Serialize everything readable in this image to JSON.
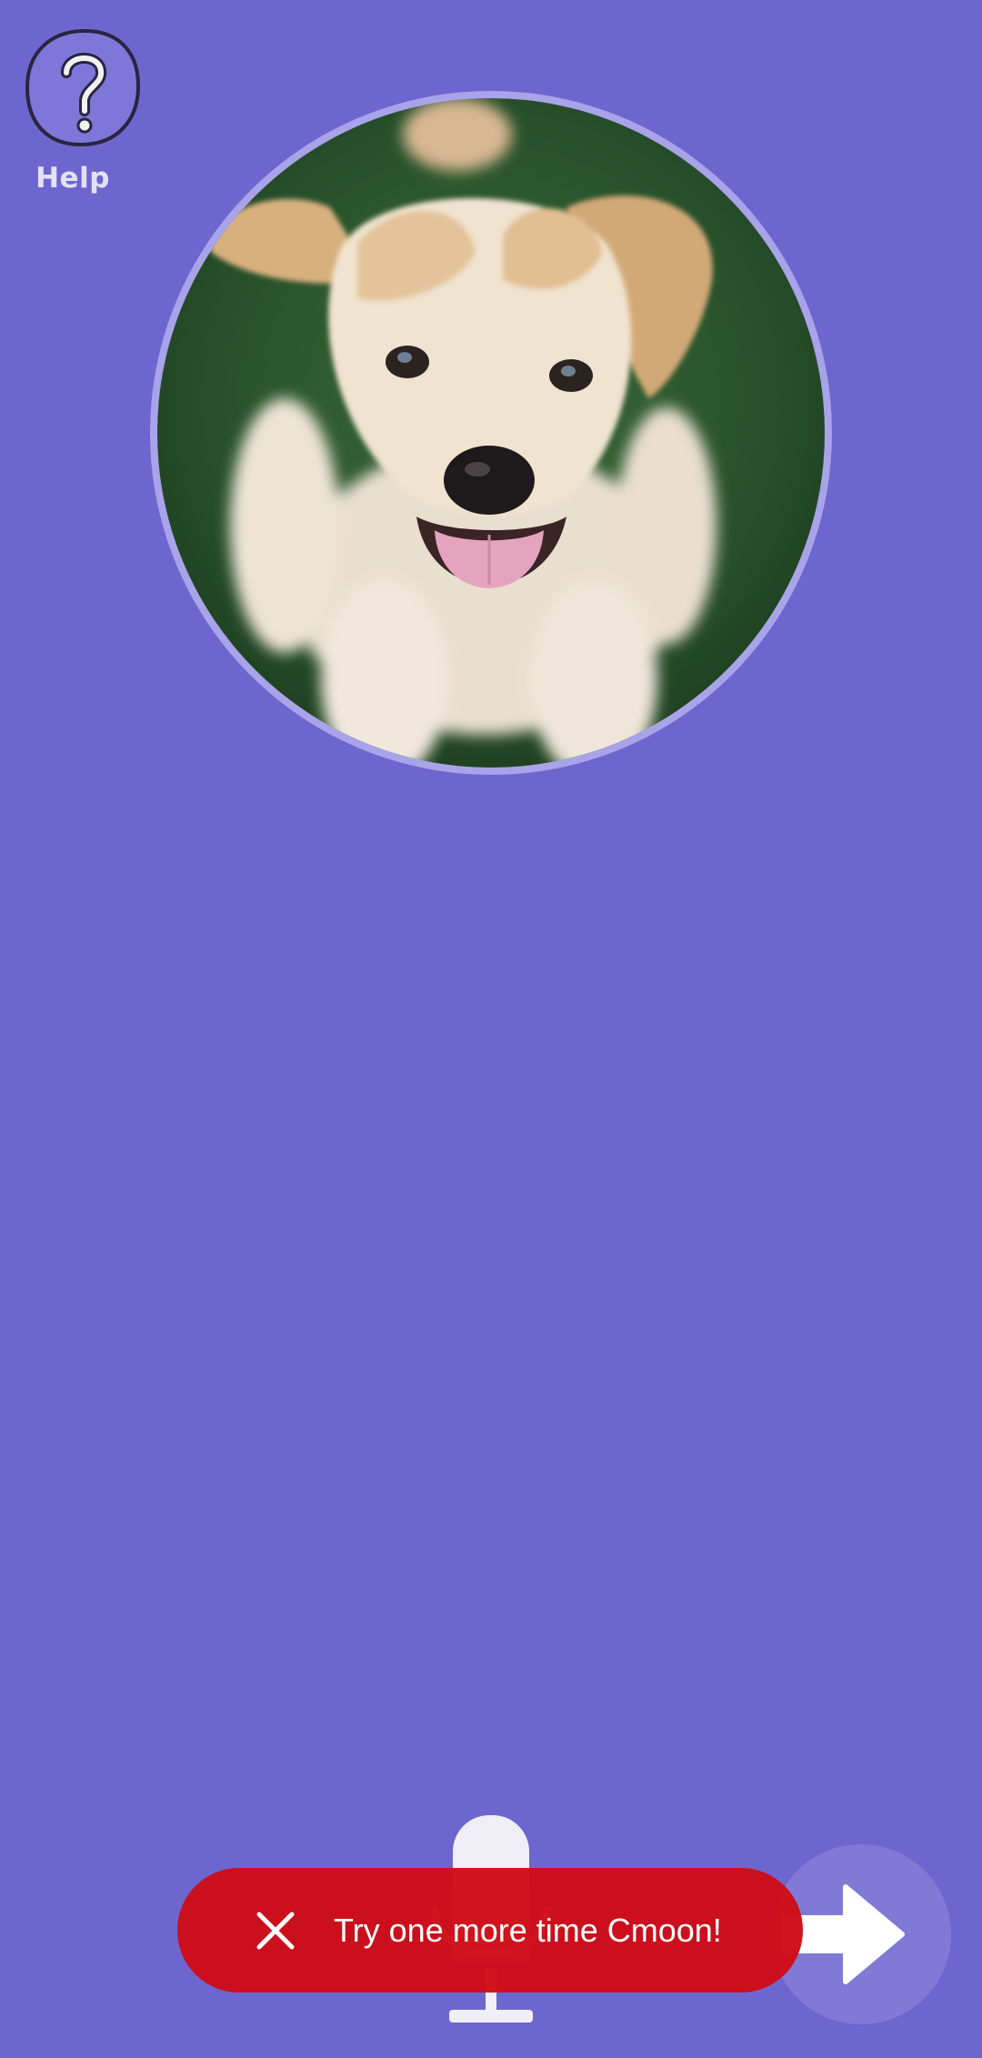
{
  "help": {
    "label": "Help",
    "icon": "help-question-icon"
  },
  "photo": {
    "subject": "puppy-image"
  },
  "mic": {
    "icon": "microphone-icon"
  },
  "next": {
    "icon": "arrow-right-icon"
  },
  "toast": {
    "close_icon": "close-icon",
    "message": "Try one more time Cmoon!"
  },
  "colors": {
    "background": "#6e66cf",
    "photo_ring": "#a9a3e9",
    "toast": "#cf0c16",
    "help_label": "#e4e1f8",
    "next_button": "#8079d6"
  }
}
